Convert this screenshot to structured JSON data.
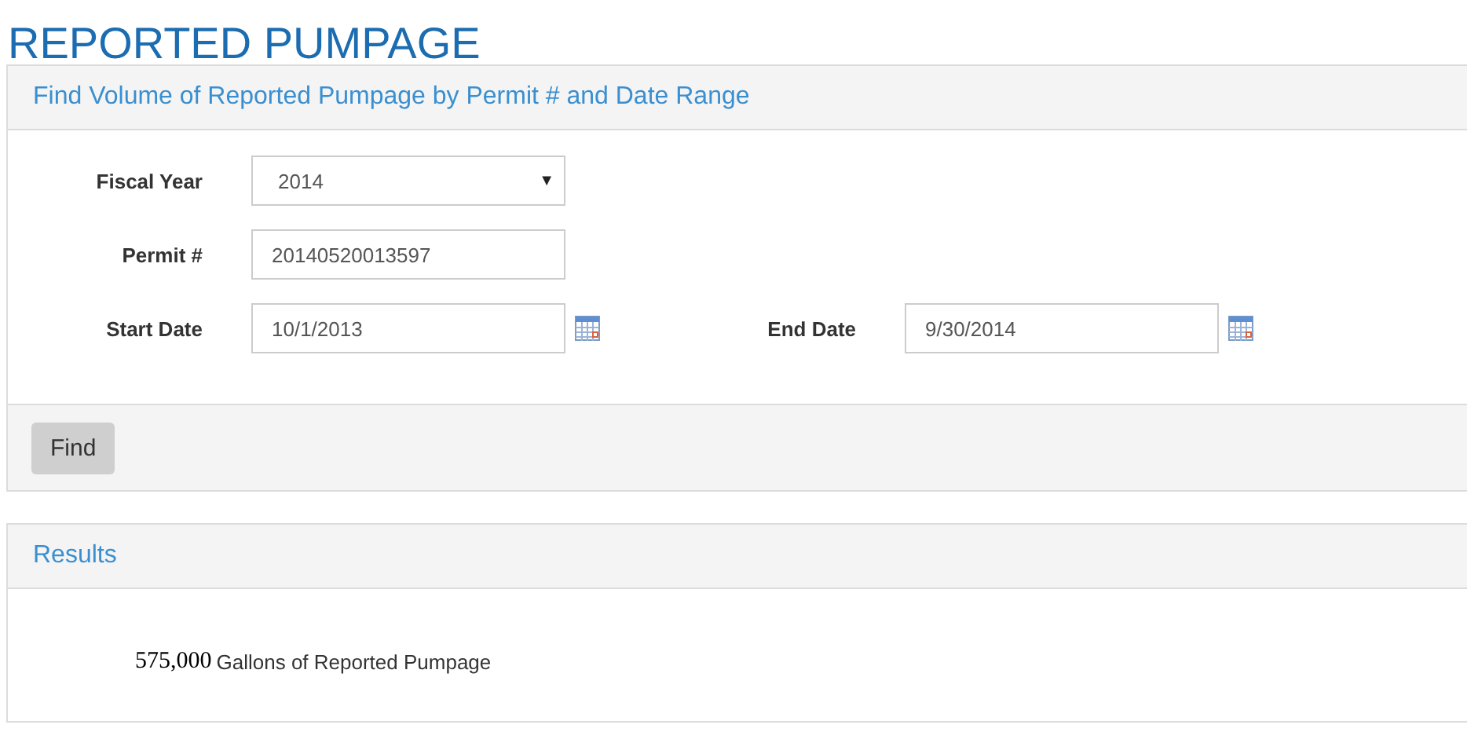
{
  "page": {
    "title": "REPORTED PUMPAGE"
  },
  "search_panel": {
    "title": "Find Volume of Reported Pumpage by Permit # and Date Range",
    "rows": [
      {
        "fields": [
          {
            "kind": "select",
            "label": "Fiscal Year",
            "value": "2014",
            "arrow": "▼"
          }
        ]
      },
      {
        "fields": [
          {
            "kind": "text",
            "label": "Permit #",
            "value": "20140520013597"
          }
        ]
      },
      {
        "fields": [
          {
            "kind": "date",
            "label": "Start Date",
            "value": "10/1/2013"
          },
          {
            "kind": "date",
            "label": "End Date",
            "value": "9/30/2014"
          }
        ]
      }
    ],
    "buttons": [
      "Find"
    ]
  },
  "results_panel": {
    "title": "Results",
    "amount": "575,000",
    "unit_label": "Gallons of Reported Pumpage"
  }
}
